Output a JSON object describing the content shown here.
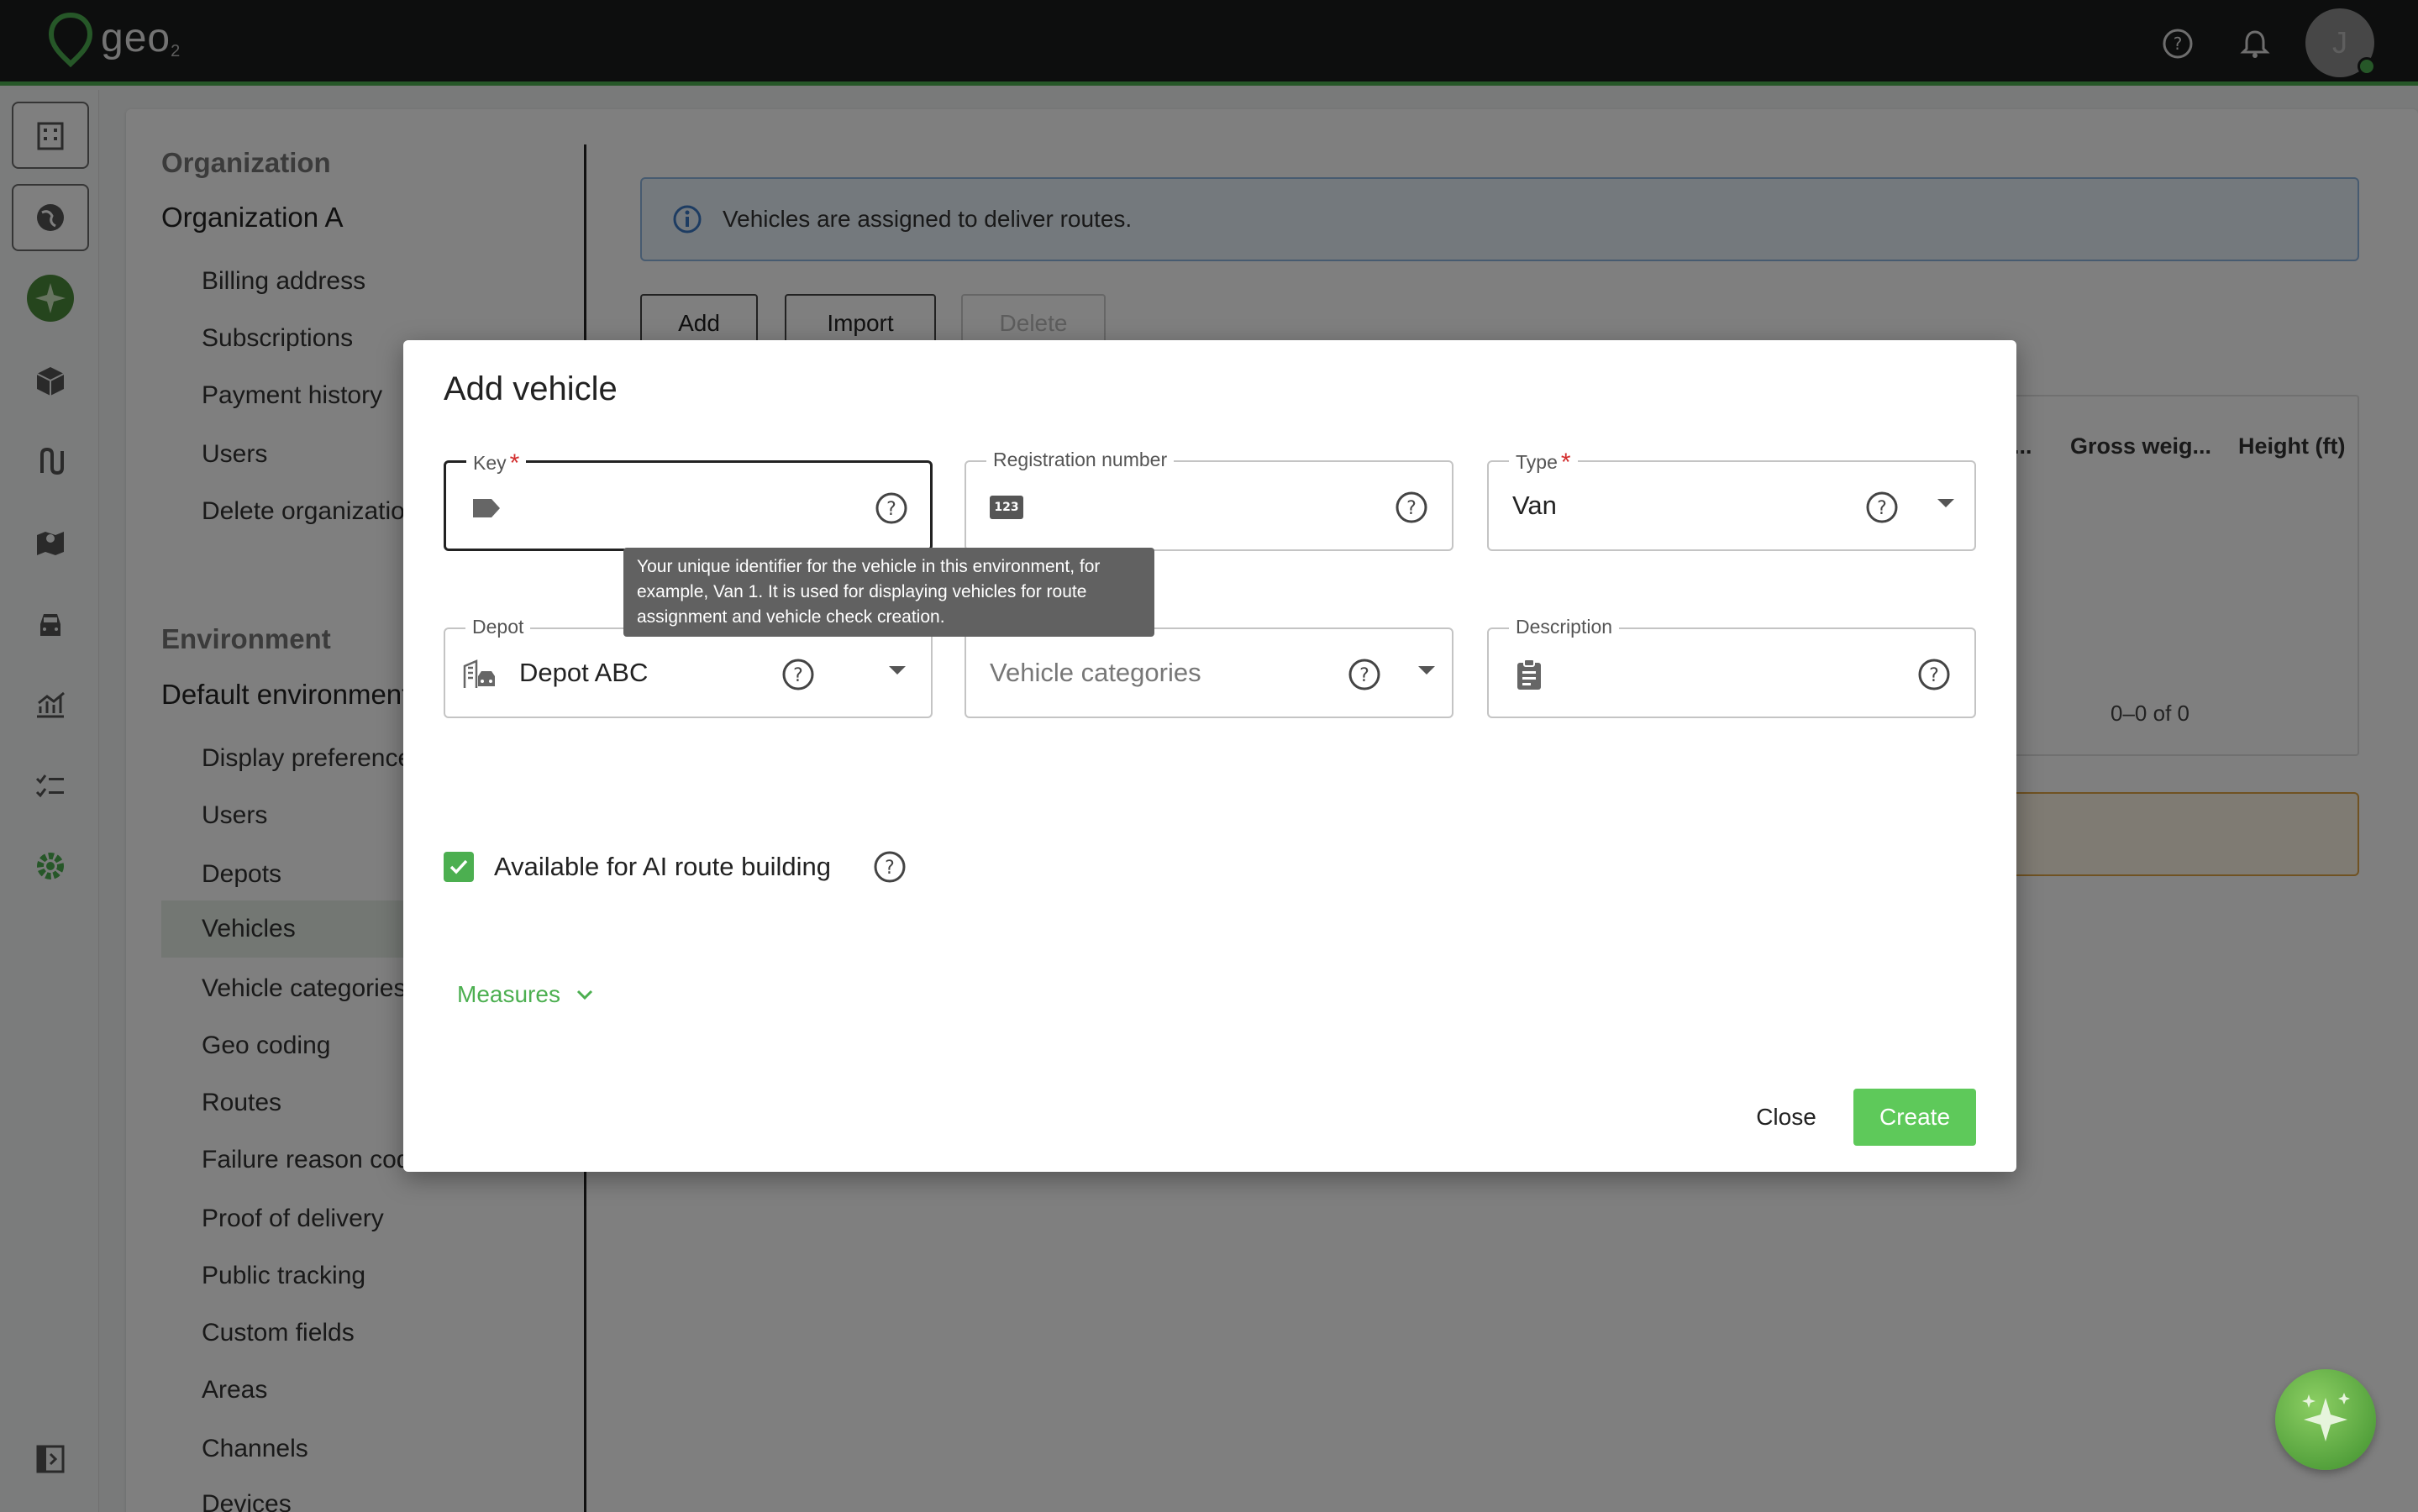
{
  "app": {
    "logo_text": "geo",
    "logo_sub": "2",
    "avatar_initial": "J"
  },
  "settings_nav": {
    "org_heading": "Organization",
    "org_name": "Organization A",
    "org_items": [
      "Billing address",
      "Subscriptions",
      "Payment history",
      "Users",
      "Delete organization"
    ],
    "env_heading": "Environment",
    "env_name": "Default environment",
    "env_items": [
      "Display preferences",
      "Users",
      "Depots",
      "Vehicles",
      "Vehicle categories",
      "Geo coding",
      "Routes",
      "Failure reason codes",
      "Proof of delivery",
      "Public tracking",
      "Custom fields",
      "Areas",
      "Channels",
      "Devices"
    ],
    "active_item": "Vehicles"
  },
  "main": {
    "info_text": "Vehicles are assigned to deliver routes.",
    "add_label": "Add",
    "import_label": "Import",
    "delete_label": "Delete",
    "columns": [
      "...",
      "Gross weig...",
      "Height (ft)"
    ],
    "pager_text": "0–0 of 0"
  },
  "dialog": {
    "title": "Add vehicle",
    "key": {
      "label": "Key",
      "value": ""
    },
    "registration": {
      "label": "Registration number",
      "value": "",
      "badge": "123"
    },
    "type": {
      "label": "Type",
      "value": "Van"
    },
    "depot": {
      "label": "Depot",
      "value": "Depot ABC"
    },
    "categories": {
      "placeholder": "Vehicle categories"
    },
    "description": {
      "label": "Description",
      "value": ""
    },
    "tooltip": "Your unique identifier for the vehicle in this environment, for example, Van 1. It is used for displaying vehicles for route assignment and vehicle check creation.",
    "ai_label": "Available for AI route building",
    "ai_checked": true,
    "measures_label": "Measures",
    "close_label": "Close",
    "create_label": "Create"
  },
  "colors": {
    "brand_green": "#4caf50",
    "create_green": "#5ec95a",
    "required_red": "#d32f2f"
  }
}
